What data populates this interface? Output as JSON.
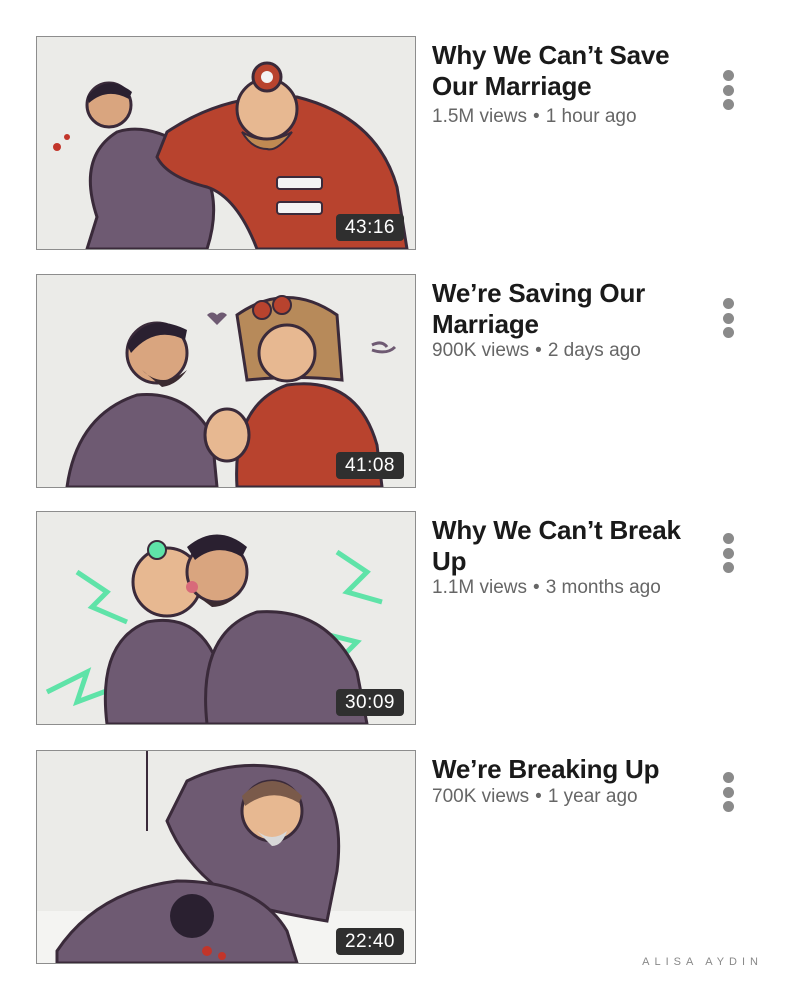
{
  "videos": [
    {
      "title": "Why We Can’t Save Our Marriage",
      "views": "1.5M views",
      "age": "1 hour ago",
      "duration": "43:16"
    },
    {
      "title": "We’re Saving Our Marriage",
      "views": "900K views",
      "age": "2 days ago",
      "duration": "41:08"
    },
    {
      "title": "Why We Can’t Break Up",
      "views": "1.1M views",
      "age": "3 months ago",
      "duration": "30:09"
    },
    {
      "title": "We’re Breaking Up",
      "views": "700K views",
      "age": "1 year ago",
      "duration": "22:40"
    }
  ],
  "separator": "•",
  "signature": "ALISA AYDIN",
  "colors": {
    "thumbnail_bg": "#ebebe8",
    "duration_badge": "#2f2f2f",
    "meta_text": "#666666",
    "red_jacket": "#b8432e",
    "purple_suit": "#6e5a72",
    "green_lightning": "#5fe3a8"
  }
}
